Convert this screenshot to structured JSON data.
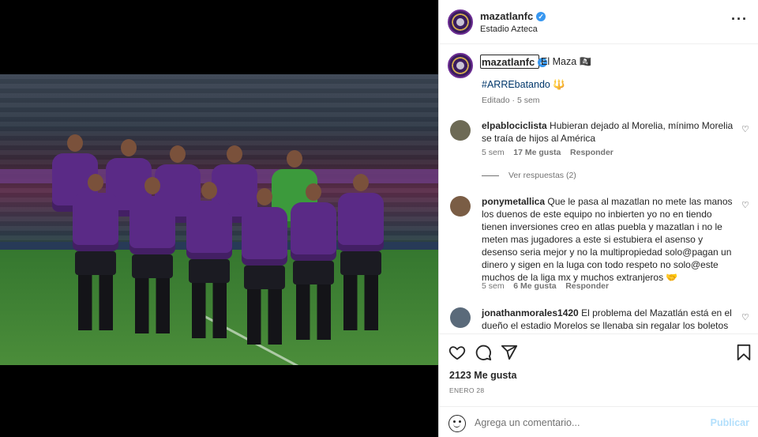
{
  "header": {
    "username": "mazatlanfc",
    "location": "Estadio Azteca",
    "more_icon": "more-horizontal-icon"
  },
  "caption": {
    "username": "mazatlanfc",
    "text": "El Maza 🏴‍☠️",
    "hashtag": "#ARREbatando 🔱",
    "meta": "Editado · 5 sem"
  },
  "comments": [
    {
      "username": "elpablociclista",
      "text": "Hubieran dejado al Morelia, mínimo Morelia se traía de hijos al América",
      "time": "5 sem",
      "likes": "17 Me gusta",
      "reply": "Responder",
      "view_replies": "Ver respuestas (2)"
    },
    {
      "username": "ponymetallica",
      "text": "Que le pasa al mazatlan no mete las manos los duenos de este equipo no inbierten yo no en tiendo tienen inversiones creo en atlas puebla y mazatlan i no le meten mas jugadores a este si estubiera el asenso y desenso seria mejor y no la multipropiedad solo@pagan un dinero y sigen en la luga con todo respeto no solo@este muchos de la liga mx y muchos extranjeros 🤝",
      "time": "5 sem",
      "likes": "6 Me gusta",
      "reply": "Responder"
    },
    {
      "username": "jonathanmorales1420",
      "text": "El problema del Mazatlán está en el dueño el estadio Morelos se llenaba sin regalar los boletos me"
    }
  ],
  "actions": {
    "like_icon": "heart-icon",
    "comment_icon": "comment-icon",
    "share_icon": "send-icon",
    "save_icon": "bookmark-icon"
  },
  "likes": "2123 Me gusta",
  "date": "ENERO 28",
  "composer": {
    "placeholder": "Agrega un comentario...",
    "post_label": "Publicar",
    "emoji_icon": "emoji-icon"
  }
}
